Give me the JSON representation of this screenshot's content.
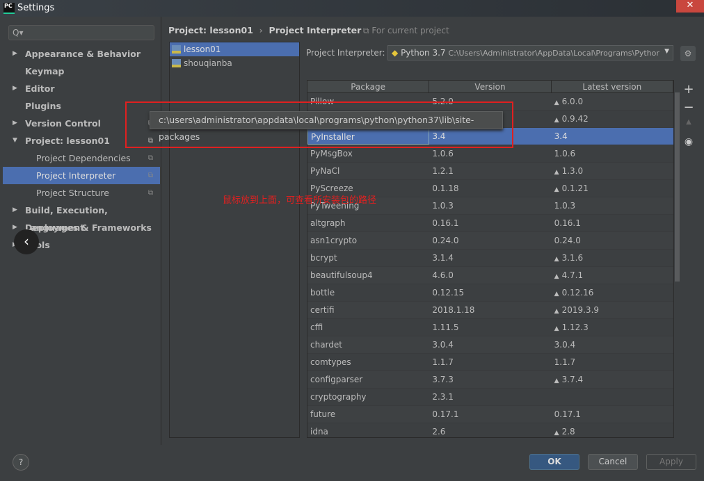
{
  "window": {
    "title": "Settings",
    "logo": "PC",
    "close": "✕"
  },
  "sidebar": {
    "search_placeholder": "Q▾",
    "items": [
      {
        "label": "Appearance & Behavior",
        "arrow": "▶"
      },
      {
        "label": "Keymap",
        "arrow": ""
      },
      {
        "label": "Editor",
        "arrow": "▶"
      },
      {
        "label": "Plugins",
        "arrow": ""
      },
      {
        "label": "Version Control",
        "arrow": "▶"
      },
      {
        "label": "Project: lesson01",
        "arrow": "▼"
      },
      {
        "label": "Project Dependencies",
        "arrow": ""
      },
      {
        "label": "Project Interpreter",
        "arrow": ""
      },
      {
        "label": "Project Structure",
        "arrow": ""
      },
      {
        "label": "Build, Execution, Deployment",
        "arrow": "▶"
      },
      {
        "label": "Languages & Frameworks",
        "arrow": "▶"
      },
      {
        "label": "Tools",
        "arrow": "▶"
      }
    ]
  },
  "breadcrumb": {
    "parent": "Project: lesson01",
    "sep": "›",
    "current": "Project Interpreter",
    "scope": "⧉ For current project"
  },
  "projects": [
    "lesson01",
    "shouqianba"
  ],
  "interpreter": {
    "label": "Project Interpreter:",
    "name": "Python 3.7",
    "path": "C:\\Users\\Administrator\\AppData\\Local\\Programs\\Pythor"
  },
  "table": {
    "headers": [
      "Package",
      "Version",
      "Latest version"
    ],
    "rows": [
      [
        "Pillow",
        "5.2.0",
        "6.0.0",
        true
      ],
      [
        "",
        "",
        "0.9.42",
        true
      ],
      [
        "PyInstaller",
        "3.4",
        "3.4",
        false
      ],
      [
        "PyMsgBox",
        "1.0.6",
        "1.0.6",
        false
      ],
      [
        "PyNaCl",
        "1.2.1",
        "1.3.0",
        true
      ],
      [
        "PyScreeze",
        "0.1.18",
        "0.1.21",
        true
      ],
      [
        "PyTweening",
        "1.0.3",
        "1.0.3",
        false
      ],
      [
        "altgraph",
        "0.16.1",
        "0.16.1",
        false
      ],
      [
        "asn1crypto",
        "0.24.0",
        "0.24.0",
        false
      ],
      [
        "bcrypt",
        "3.1.4",
        "3.1.6",
        true
      ],
      [
        "beautifulsoup4",
        "4.6.0",
        "4.7.1",
        true
      ],
      [
        "bottle",
        "0.12.15",
        "0.12.16",
        true
      ],
      [
        "certifi",
        "2018.1.18",
        "2019.3.9",
        true
      ],
      [
        "cffi",
        "1.11.5",
        "1.12.3",
        true
      ],
      [
        "chardet",
        "3.0.4",
        "3.0.4",
        false
      ],
      [
        "comtypes",
        "1.1.7",
        "1.1.7",
        false
      ],
      [
        "configparser",
        "3.7.3",
        "3.7.4",
        true
      ],
      [
        "cryptography",
        "2.3.1",
        "",
        false
      ],
      [
        "future",
        "0.17.1",
        "0.17.1",
        false
      ],
      [
        "idna",
        "2.6",
        "2.8",
        true
      ]
    ]
  },
  "tooltip": "c:\\users\\administrator\\appdata\\local\\programs\\python\\python37\\lib\\site-packages",
  "annotation": "鼠标放到上面，可查看所安装包的路径",
  "tools": [
    "+",
    "−",
    "▲",
    "◉"
  ],
  "buttons": {
    "help": "?",
    "ok": "OK",
    "cancel": "Cancel",
    "apply": "Apply"
  },
  "colors": {
    "selection": "#4b6eaf",
    "annotation": "#e02020"
  }
}
